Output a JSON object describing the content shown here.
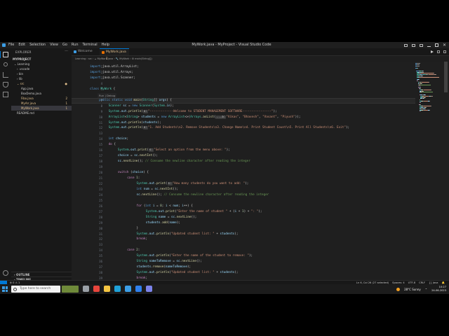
{
  "window": {
    "title": "MyWork.java - MyProject - Visual Studio Code",
    "menu": [
      "File",
      "Edit",
      "Selection",
      "View",
      "Go",
      "Run",
      "Terminal",
      "Help"
    ]
  },
  "sidebar": {
    "title": "EXPLORER",
    "more": "···",
    "project": "MYPROJECT",
    "items": [
      {
        "label": "⌄ Learning",
        "indent": 4,
        "color": "#cccccc",
        "badge": ""
      },
      {
        "label": "› .vscode",
        "indent": 8,
        "color": "#cccccc",
        "badge": ""
      },
      {
        "label": "› bin",
        "indent": 8,
        "color": "#cccccc",
        "badge": ""
      },
      {
        "label": "› lib",
        "indent": 8,
        "color": "#cccccc",
        "badge": ""
      },
      {
        "label": "⌄ src",
        "indent": 8,
        "color": "#e2c08d",
        "badge": "●"
      },
      {
        "label": "App.java",
        "indent": 14,
        "color": "#cccccc",
        "badge": ""
      },
      {
        "label": "BoxDemo.java",
        "indent": 14,
        "color": "#cccccc",
        "badge": ""
      },
      {
        "label": "Fibo.java",
        "indent": 14,
        "color": "#e2c08d",
        "badge": "2"
      },
      {
        "label": "MyArr.java",
        "indent": 14,
        "color": "#e2c08d",
        "badge": "1"
      },
      {
        "label": "MyWork.java",
        "indent": 14,
        "color": "#e2c08d",
        "badge": "1"
      },
      {
        "label": "README.md",
        "indent": 8,
        "color": "#cccccc",
        "badge": ""
      }
    ],
    "bottom_sections": [
      "› OUTLINE",
      "› TIMELINE",
      "› JAVA PROJECTS"
    ]
  },
  "tabs": [
    {
      "label": "Welcome"
    },
    {
      "label": "MyWork.java 1"
    }
  ],
  "breadcrumb": "Learning › src › ☕ MyWork.java › 🔧 MyWork › ⚙ main(String[])",
  "editor": {
    "current_line": 7,
    "codelens": "Run | Debug",
    "lines": [
      {
        "n": 1,
        "indent": 0,
        "tokens": [
          [
            "kw",
            "import "
          ],
          [
            "pl",
            "java.util.ArrayList;"
          ]
        ]
      },
      {
        "n": 2,
        "indent": 0,
        "tokens": [
          [
            "kw",
            "import "
          ],
          [
            "pl",
            "java.util.Arrays;"
          ]
        ]
      },
      {
        "n": 3,
        "indent": 0,
        "tokens": [
          [
            "kw",
            "import "
          ],
          [
            "pl",
            "java.util.Scanner;"
          ]
        ]
      },
      {
        "n": 4,
        "indent": 0,
        "tokens": []
      },
      {
        "n": 5,
        "indent": 0,
        "tokens": [
          [
            "kw",
            "class "
          ],
          [
            "ty",
            "MyWork"
          ],
          [
            "pl",
            " {"
          ]
        ]
      },
      {
        "n": 6,
        "indent": 1,
        "tokens": []
      },
      {
        "n": 7,
        "indent": 1,
        "tokens": [
          [
            "kw",
            "public static void "
          ],
          [
            "fn",
            "main"
          ],
          [
            "pl",
            "("
          ],
          [
            "ty",
            "String"
          ],
          [
            "pl",
            "[] "
          ],
          [
            "va",
            "args"
          ],
          [
            "pl",
            ") {"
          ]
        ]
      },
      {
        "n": 8,
        "indent": 2,
        "tokens": [
          [
            "ty",
            "Scanner "
          ],
          [
            "va",
            "sc"
          ],
          [
            "pl",
            " = "
          ],
          [
            "kw",
            "new "
          ],
          [
            "ty",
            "Scanner"
          ],
          [
            "pl",
            "("
          ],
          [
            "ty",
            "System"
          ],
          [
            "pl",
            "."
          ],
          [
            "va",
            "in"
          ],
          [
            "pl",
            ");"
          ]
        ]
      },
      {
        "n": 9,
        "indent": 2,
        "tokens": [
          [
            "ty",
            "System"
          ],
          [
            "pl",
            "."
          ],
          [
            "va",
            "out"
          ],
          [
            "pl",
            "."
          ],
          [
            "fn",
            "println"
          ],
          [
            "pl",
            "("
          ],
          [
            "hint",
            "x:"
          ],
          [
            "st",
            "\"-------------Welcome to STUDENT MANAGEMENT SOFTWARE----------------\""
          ],
          [
            "pl",
            ");"
          ]
        ]
      },
      {
        "n": 10,
        "indent": 2,
        "tokens": [
          [
            "ty",
            "ArrayList"
          ],
          [
            "pl",
            "<"
          ],
          [
            "ty",
            "String"
          ],
          [
            "pl",
            "> "
          ],
          [
            "va",
            "students"
          ],
          [
            "pl",
            " = "
          ],
          [
            "kw",
            "new "
          ],
          [
            "ty",
            "ArrayList"
          ],
          [
            "pl",
            "<>("
          ],
          [
            "ty",
            "Arrays"
          ],
          [
            "pl",
            "."
          ],
          [
            "fn",
            "asList"
          ],
          [
            "pl",
            "("
          ],
          [
            "hint",
            "...a:"
          ],
          [
            "st",
            "\"Vikas\""
          ],
          [
            "pl",
            ", "
          ],
          [
            "st",
            "\"Bhavesh\""
          ],
          [
            "pl",
            ", "
          ],
          [
            "st",
            "\"Vasant\""
          ],
          [
            "pl",
            ", "
          ],
          [
            "st",
            "\"Piyush\""
          ],
          [
            "pl",
            "));"
          ]
        ]
      },
      {
        "n": 11,
        "indent": 2,
        "tokens": [
          [
            "ty",
            "System"
          ],
          [
            "pl",
            "."
          ],
          [
            "va",
            "out"
          ],
          [
            "pl",
            "."
          ],
          [
            "fn",
            "println"
          ],
          [
            "pl",
            "("
          ],
          [
            "va",
            "students"
          ],
          [
            "pl",
            ");"
          ]
        ]
      },
      {
        "n": 12,
        "indent": 2,
        "tokens": [
          [
            "ty",
            "System"
          ],
          [
            "pl",
            "."
          ],
          [
            "va",
            "out"
          ],
          [
            "pl",
            "."
          ],
          [
            "fn",
            "println"
          ],
          [
            "pl",
            "("
          ],
          [
            "hint",
            "x:"
          ],
          [
            "st",
            "\"1. Add Students\\n2. Remove Students\\n3. Change Name\\n4. Print Student Count\\n5. Print All Students\\n6. Exit\""
          ],
          [
            "pl",
            ");"
          ]
        ]
      },
      {
        "n": 13,
        "indent": 2,
        "tokens": []
      },
      {
        "n": 14,
        "indent": 2,
        "tokens": [
          [
            "kw",
            "int "
          ],
          [
            "va",
            "choice"
          ],
          [
            "pl",
            ";"
          ]
        ]
      },
      {
        "n": 15,
        "indent": 2,
        "tokens": [
          [
            "ctl",
            "do"
          ],
          [
            "pl",
            " {"
          ]
        ]
      },
      {
        "n": 16,
        "indent": 3,
        "tokens": [
          [
            "ty",
            "System"
          ],
          [
            "pl",
            "."
          ],
          [
            "va",
            "out"
          ],
          [
            "pl",
            "."
          ],
          [
            "fn",
            "print"
          ],
          [
            "pl",
            "("
          ],
          [
            "hint",
            "s:"
          ],
          [
            "st",
            "\"Select an option from the menu above: \""
          ],
          [
            "pl",
            ");"
          ]
        ]
      },
      {
        "n": 17,
        "indent": 3,
        "tokens": [
          [
            "va",
            "choice"
          ],
          [
            "pl",
            " = "
          ],
          [
            "va",
            "sc"
          ],
          [
            "pl",
            "."
          ],
          [
            "fn",
            "nextInt"
          ],
          [
            "pl",
            "();"
          ]
        ]
      },
      {
        "n": 18,
        "indent": 3,
        "tokens": [
          [
            "va",
            "sc"
          ],
          [
            "pl",
            "."
          ],
          [
            "fn",
            "nextLine"
          ],
          [
            "pl",
            "(); "
          ],
          [
            "cm",
            "// Consume the newline character after reading the integer"
          ]
        ]
      },
      {
        "n": 19,
        "indent": 3,
        "tokens": []
      },
      {
        "n": 20,
        "indent": 3,
        "tokens": [
          [
            "ctl",
            "switch"
          ],
          [
            "pl",
            " ("
          ],
          [
            "va",
            "choice"
          ],
          [
            "pl",
            ") {"
          ]
        ]
      },
      {
        "n": 21,
        "indent": 4,
        "tokens": [
          [
            "ctl",
            "case "
          ],
          [
            "nu",
            "1"
          ],
          [
            "pl",
            ":"
          ]
        ]
      },
      {
        "n": 22,
        "indent": 5,
        "tokens": [
          [
            "ty",
            "System"
          ],
          [
            "pl",
            "."
          ],
          [
            "va",
            "out"
          ],
          [
            "pl",
            "."
          ],
          [
            "fn",
            "print"
          ],
          [
            "pl",
            "("
          ],
          [
            "hint",
            "s:"
          ],
          [
            "st",
            "\"How many students do you want to add: \""
          ],
          [
            "pl",
            ");"
          ]
        ]
      },
      {
        "n": 23,
        "indent": 5,
        "tokens": [
          [
            "kw",
            "int "
          ],
          [
            "va",
            "num"
          ],
          [
            "pl",
            " = "
          ],
          [
            "va",
            "sc"
          ],
          [
            "pl",
            "."
          ],
          [
            "fn",
            "nextInt"
          ],
          [
            "pl",
            "();"
          ]
        ]
      },
      {
        "n": 24,
        "indent": 5,
        "tokens": [
          [
            "va",
            "sc"
          ],
          [
            "pl",
            "."
          ],
          [
            "fn",
            "nextLine"
          ],
          [
            "pl",
            "(); "
          ],
          [
            "cm",
            "// Consume the newline character after reading the integer"
          ]
        ]
      },
      {
        "n": 25,
        "indent": 5,
        "tokens": []
      },
      {
        "n": 26,
        "indent": 5,
        "tokens": [
          [
            "ctl",
            "for"
          ],
          [
            "pl",
            " ("
          ],
          [
            "kw",
            "int "
          ],
          [
            "va",
            "i"
          ],
          [
            "pl",
            " = "
          ],
          [
            "nu",
            "0"
          ],
          [
            "pl",
            "; "
          ],
          [
            "va",
            "i"
          ],
          [
            "pl",
            " < "
          ],
          [
            "va",
            "num"
          ],
          [
            "pl",
            "; "
          ],
          [
            "va",
            "i"
          ],
          [
            "pl",
            "++) {"
          ]
        ]
      },
      {
        "n": 27,
        "indent": 6,
        "tokens": [
          [
            "ty",
            "System"
          ],
          [
            "pl",
            "."
          ],
          [
            "va",
            "out"
          ],
          [
            "pl",
            "."
          ],
          [
            "fn",
            "print"
          ],
          [
            "pl",
            "("
          ],
          [
            "st",
            "\"Enter the name of student \""
          ],
          [
            "pl",
            " + ("
          ],
          [
            "va",
            "i"
          ],
          [
            "pl",
            " + "
          ],
          [
            "nu",
            "1"
          ],
          [
            "pl",
            ") + "
          ],
          [
            "st",
            "\": \""
          ],
          [
            "pl",
            ");"
          ]
        ]
      },
      {
        "n": 28,
        "indent": 6,
        "tokens": [
          [
            "ty",
            "String "
          ],
          [
            "va",
            "name"
          ],
          [
            "pl",
            " = "
          ],
          [
            "va",
            "sc"
          ],
          [
            "pl",
            "."
          ],
          [
            "fn",
            "nextLine"
          ],
          [
            "pl",
            "();"
          ]
        ]
      },
      {
        "n": 29,
        "indent": 6,
        "tokens": [
          [
            "va",
            "students"
          ],
          [
            "pl",
            "."
          ],
          [
            "fn",
            "add"
          ],
          [
            "pl",
            "("
          ],
          [
            "va",
            "name"
          ],
          [
            "pl",
            ");"
          ]
        ]
      },
      {
        "n": 30,
        "indent": 5,
        "tokens": [
          [
            "pl",
            "}"
          ]
        ]
      },
      {
        "n": 31,
        "indent": 5,
        "tokens": [
          [
            "ty",
            "System"
          ],
          [
            "pl",
            "."
          ],
          [
            "va",
            "out"
          ],
          [
            "pl",
            "."
          ],
          [
            "fn",
            "println"
          ],
          [
            "pl",
            "("
          ],
          [
            "st",
            "\"Updated student list: \""
          ],
          [
            "pl",
            " + "
          ],
          [
            "va",
            "students"
          ],
          [
            "pl",
            ");"
          ]
        ]
      },
      {
        "n": 32,
        "indent": 5,
        "tokens": [
          [
            "ctl",
            "break"
          ],
          [
            "pl",
            ";"
          ]
        ]
      },
      {
        "n": 33,
        "indent": 4,
        "tokens": []
      },
      {
        "n": 34,
        "indent": 4,
        "tokens": [
          [
            "ctl",
            "case "
          ],
          [
            "nu",
            "2"
          ],
          [
            "pl",
            ":"
          ]
        ]
      },
      {
        "n": 35,
        "indent": 5,
        "tokens": [
          [
            "ty",
            "System"
          ],
          [
            "pl",
            "."
          ],
          [
            "va",
            "out"
          ],
          [
            "pl",
            "."
          ],
          [
            "fn",
            "println"
          ],
          [
            "pl",
            "("
          ],
          [
            "st",
            "\"Enter the name of the student to remove: \""
          ],
          [
            "pl",
            ");"
          ]
        ]
      },
      {
        "n": 36,
        "indent": 5,
        "tokens": [
          [
            "ty",
            "String "
          ],
          [
            "va",
            "nameToRemove"
          ],
          [
            "pl",
            " = "
          ],
          [
            "va",
            "sc"
          ],
          [
            "pl",
            "."
          ],
          [
            "fn",
            "nextLine"
          ],
          [
            "pl",
            "();"
          ]
        ]
      },
      {
        "n": 37,
        "indent": 5,
        "tokens": [
          [
            "va",
            "students"
          ],
          [
            "pl",
            "."
          ],
          [
            "fn",
            "remove"
          ],
          [
            "pl",
            "("
          ],
          [
            "va",
            "nameToRemove"
          ],
          [
            "pl",
            ");"
          ]
        ]
      },
      {
        "n": 38,
        "indent": 5,
        "tokens": [
          [
            "ty",
            "System"
          ],
          [
            "pl",
            "."
          ],
          [
            "va",
            "out"
          ],
          [
            "pl",
            "."
          ],
          [
            "fn",
            "println"
          ],
          [
            "pl",
            "("
          ],
          [
            "st",
            "\"Updated student list: \""
          ],
          [
            "pl",
            " + "
          ],
          [
            "va",
            "students"
          ],
          [
            "pl",
            ");"
          ]
        ]
      },
      {
        "n": 39,
        "indent": 5,
        "tokens": [
          [
            "ctl",
            "break"
          ],
          [
            "pl",
            ";"
          ]
        ]
      }
    ]
  },
  "status": {
    "left": "⊗ 0 ⚠ 1",
    "right": [
      "Ln 6, Col 26 (27 selected)",
      "Spaces: 4",
      "UTF-8",
      "CRLF",
      "{} Java",
      "🔔"
    ]
  },
  "taskbar": {
    "search_placeholder": "Type here to search",
    "weather": "28°C Sunny",
    "time": "10:27",
    "date": "24-06-2023",
    "apps": [
      {
        "icon": "task-view-icon",
        "color": "#9aa0a6"
      },
      {
        "icon": "chrome-icon",
        "color": "#e8453c"
      },
      {
        "icon": "explorer-icon",
        "color": "#f4c542"
      },
      {
        "icon": "edge-icon",
        "color": "#1fa1d8"
      },
      {
        "icon": "store-icon",
        "color": "#3c9ee6"
      },
      {
        "icon": "vscode-icon",
        "color": "#2f80ed"
      },
      {
        "icon": "teams-icon",
        "color": "#7b83eb"
      }
    ]
  }
}
